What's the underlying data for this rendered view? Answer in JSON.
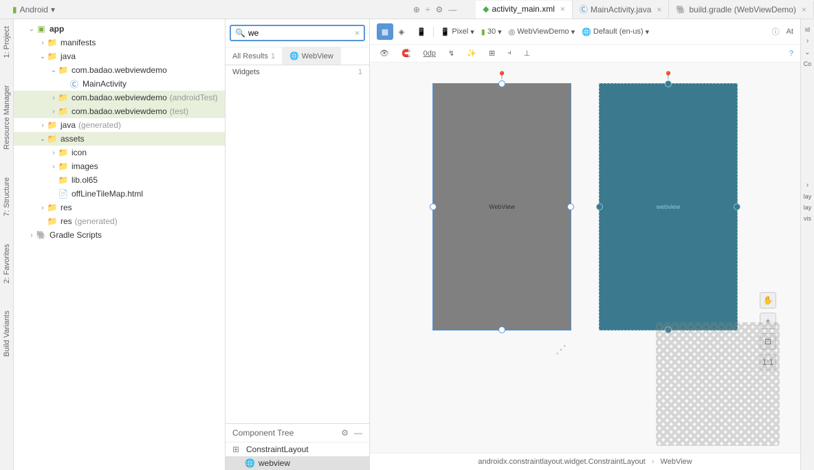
{
  "topbar": {
    "module_dropdown": "Android",
    "tabs": [
      {
        "label": "activity_main.xml",
        "type": "xml",
        "active": true
      },
      {
        "label": "MainActivity.java",
        "type": "java",
        "active": false
      },
      {
        "label": "build.gradle (WebViewDemo)",
        "type": "gradle",
        "active": false
      }
    ]
  },
  "leftbar": {
    "labels": [
      "1: Project",
      "Resource Manager",
      "7: Structure",
      "2: Favorites",
      "Build Variants"
    ]
  },
  "project_tree": {
    "root": "app",
    "items": [
      {
        "indent": 1,
        "arrow": "v",
        "icon": "module",
        "label": "app",
        "bold": true
      },
      {
        "indent": 2,
        "arrow": ">",
        "icon": "folder",
        "label": "manifests"
      },
      {
        "indent": 2,
        "arrow": "v",
        "icon": "folder",
        "label": "java"
      },
      {
        "indent": 3,
        "arrow": "v",
        "icon": "package",
        "label": "com.badao.webviewdemo"
      },
      {
        "indent": 4,
        "arrow": "",
        "icon": "class",
        "label": "MainActivity"
      },
      {
        "indent": 3,
        "arrow": ">",
        "icon": "package",
        "label": "com.badao.webviewdemo",
        "suffix": "(androidTest)",
        "selected": true
      },
      {
        "indent": 3,
        "arrow": ">",
        "icon": "package",
        "label": "com.badao.webviewdemo",
        "suffix": "(test)",
        "selected": true
      },
      {
        "indent": 2,
        "arrow": ">",
        "icon": "folder-gen",
        "label": "java",
        "suffix": "(generated)"
      },
      {
        "indent": 2,
        "arrow": "v",
        "icon": "folder",
        "label": "assets",
        "selected": true
      },
      {
        "indent": 3,
        "arrow": ">",
        "icon": "folder-plain",
        "label": "icon"
      },
      {
        "indent": 3,
        "arrow": ">",
        "icon": "folder-plain",
        "label": "images"
      },
      {
        "indent": 3,
        "arrow": "",
        "icon": "folder-plain",
        "label": "lib.ol65"
      },
      {
        "indent": 3,
        "arrow": "",
        "icon": "html",
        "label": "offLineTileMap.html"
      },
      {
        "indent": 2,
        "arrow": ">",
        "icon": "folder-res",
        "label": "res"
      },
      {
        "indent": 2,
        "arrow": "",
        "icon": "folder-res",
        "label": "res",
        "suffix": "(generated)"
      },
      {
        "indent": 1,
        "arrow": ">",
        "icon": "gradle",
        "label": "Gradle Scripts"
      }
    ]
  },
  "palette": {
    "search_value": "we",
    "tabs": [
      {
        "label": "All Results",
        "count": "1"
      },
      {
        "label": "WebView",
        "icon": "web",
        "active": true
      }
    ],
    "items": [
      {
        "label": "Widgets",
        "count": "1"
      }
    ]
  },
  "component_tree": {
    "title": "Component Tree",
    "items": [
      {
        "indent": 0,
        "icon": "layout",
        "label": "ConstraintLayout"
      },
      {
        "indent": 1,
        "icon": "web",
        "label": "webview",
        "selected": true
      }
    ]
  },
  "design_toolbar": {
    "device": "Pixel",
    "api": "30",
    "app_theme": "WebViewDemo",
    "locale": "Default (en-us)",
    "margin": "0dp"
  },
  "canvas": {
    "design_label": "WebView",
    "blueprint_label": "webview"
  },
  "breadcrumb": {
    "parent": "androidx.constraintlayout.widget.ConstraintLayout",
    "child": "WebView"
  },
  "rightbar": {
    "title": "Attributes",
    "keys": [
      "id",
      "Co",
      "lay",
      "lay",
      "vis"
    ]
  }
}
